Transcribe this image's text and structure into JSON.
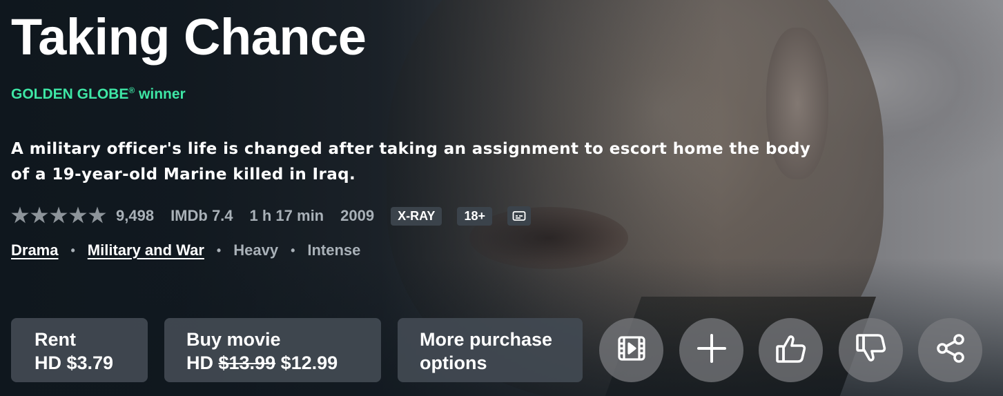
{
  "title": "Taking Chance",
  "award": {
    "text": "GOLDEN GLOBE",
    "mark": "®",
    "suffix": " winner",
    "color": "#3ee6a5"
  },
  "synopsis": "A military officer's life is changed after taking an assignment to escort home the body of a 19-year-old Marine killed in Iraq.",
  "meta": {
    "rating_stars": 5,
    "rating_count": "9,498",
    "imdb": "IMDb 7.4",
    "runtime": "1 h 17 min",
    "year": "2009",
    "xray_badge": "X-RAY",
    "age_badge": "18+",
    "subtitles_icon": "subtitles-icon"
  },
  "genres": [
    {
      "label": "Drama",
      "link": true
    },
    {
      "label": "Military and War",
      "link": true
    },
    {
      "label": "Heavy",
      "link": false
    },
    {
      "label": "Intense",
      "link": false
    }
  ],
  "separator": "•",
  "buttons": {
    "rent": {
      "line1": "Rent",
      "line2": "HD $3.79"
    },
    "buy": {
      "line1": "Buy movie",
      "prefix": "HD ",
      "old_price": "$13.99",
      "new_price": "$12.99"
    },
    "more": {
      "line1": "More purchase",
      "line2": "options"
    }
  },
  "icons": [
    "trailer-icon",
    "add-icon",
    "thumbs-up-icon",
    "thumbs-down-icon",
    "share-icon"
  ]
}
